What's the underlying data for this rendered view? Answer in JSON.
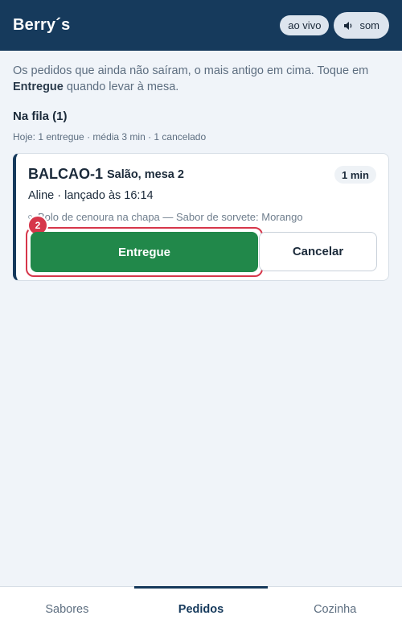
{
  "header": {
    "brand": "Berry´s",
    "live_label": "ao vivo",
    "sound_label": "som",
    "sound_icon": "speaker-icon"
  },
  "intro": {
    "text_before": "Os pedidos que ainda não saíram, o mais antigo em cima. Toque em ",
    "bold": "Entregue",
    "text_after": " quando levar à mesa."
  },
  "queue": {
    "title": "Na fila (1)",
    "stats": "Hoje: 1 entregue · média 3 min · 1 cancelado"
  },
  "order": {
    "code": "BALCAO-1",
    "table": "Salão, mesa 2",
    "elapsed": "1 min",
    "meta": "Aline · lançado às 16:14",
    "item": "Bolo de cenoura na chapa — Sabor de sorvete: Morango",
    "step_badge": "2",
    "deliver_label": "Entregue",
    "cancel_label": "Cancelar"
  },
  "nav": {
    "tabs": [
      {
        "label": "Sabores",
        "active": false
      },
      {
        "label": "Pedidos",
        "active": true
      },
      {
        "label": "Cozinha",
        "active": false
      }
    ]
  },
  "colors": {
    "header_bg": "#163a5c",
    "deliver_green": "#21884a",
    "highlight_red": "#d6364a"
  }
}
